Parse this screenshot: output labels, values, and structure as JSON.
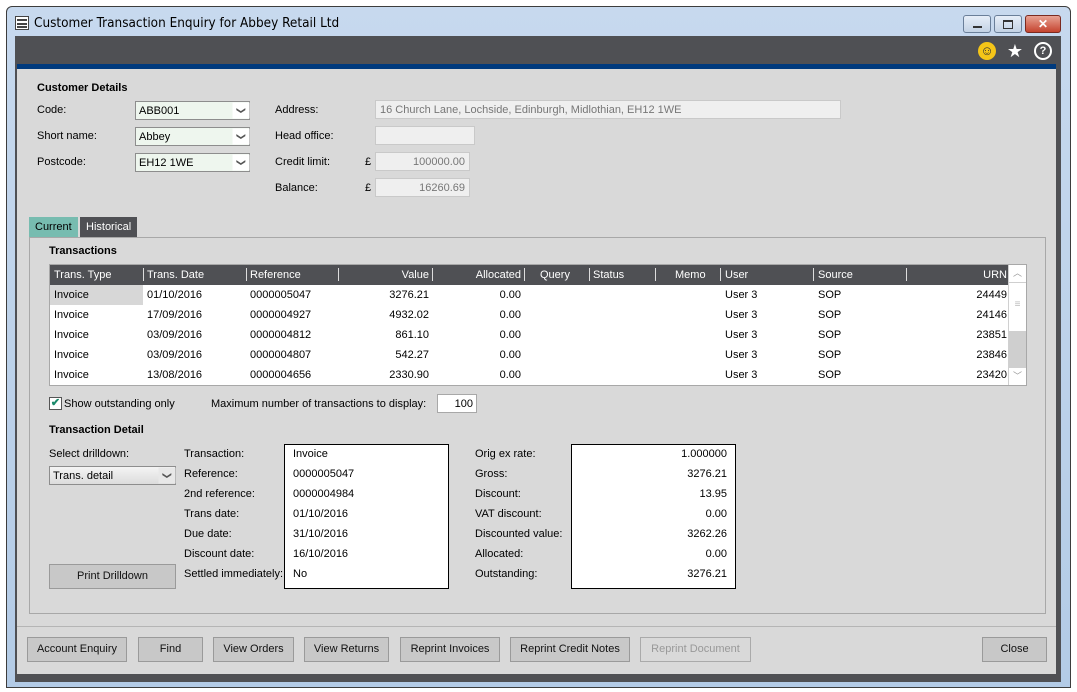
{
  "window": {
    "title": "Customer Transaction Enquiry for Abbey Retail Ltd",
    "controls": {
      "minimize": "–",
      "maximize": "□",
      "close": "✕"
    },
    "header_icons": {
      "feedback": "smiley-icon",
      "favourite": "star-icon",
      "help": "help-icon"
    }
  },
  "customer_details": {
    "heading": "Customer Details",
    "code_label": "Code:",
    "code_value": "ABB001",
    "short_name_label": "Short name:",
    "short_name_value": "Abbey",
    "postcode_label": "Postcode:",
    "postcode_value": "EH12 1WE",
    "address_label": "Address:",
    "address_value": "16 Church Lane, Lochside, Edinburgh, Midlothian, EH12 1WE",
    "head_office_label": "Head office:",
    "head_office_value": "",
    "credit_limit_label": "Credit limit:",
    "credit_limit_currency": "£",
    "credit_limit_value": "100000.00",
    "balance_label": "Balance:",
    "balance_currency": "£",
    "balance_value": "16260.69"
  },
  "tabs": [
    {
      "label": "Current",
      "active": true
    },
    {
      "label": "Historical",
      "active": false
    }
  ],
  "transactions": {
    "heading": "Transactions",
    "columns": [
      "Trans. Type",
      "Trans. Date",
      "Reference",
      "Value",
      "Allocated",
      "Query",
      "Status",
      "Memo",
      "User",
      "Source",
      "URN"
    ],
    "rows": [
      {
        "type": "Invoice",
        "date": "01/10/2016",
        "reference": "0000005047",
        "value": "3276.21",
        "allocated": "0.00",
        "query": "",
        "status": "",
        "memo": "",
        "user": "User 3",
        "source": "SOP",
        "urn": "24449"
      },
      {
        "type": "Invoice",
        "date": "17/09/2016",
        "reference": "0000004927",
        "value": "4932.02",
        "allocated": "0.00",
        "query": "",
        "status": "",
        "memo": "",
        "user": "User 3",
        "source": "SOP",
        "urn": "24146"
      },
      {
        "type": "Invoice",
        "date": "03/09/2016",
        "reference": "0000004812",
        "value": "861.10",
        "allocated": "0.00",
        "query": "",
        "status": "",
        "memo": "",
        "user": "User 3",
        "source": "SOP",
        "urn": "23851"
      },
      {
        "type": "Invoice",
        "date": "03/09/2016",
        "reference": "0000004807",
        "value": "542.27",
        "allocated": "0.00",
        "query": "",
        "status": "",
        "memo": "",
        "user": "User 3",
        "source": "SOP",
        "urn": "23846"
      },
      {
        "type": "Invoice",
        "date": "13/08/2016",
        "reference": "0000004656",
        "value": "2330.90",
        "allocated": "0.00",
        "query": "",
        "status": "",
        "memo": "",
        "user": "User 3",
        "source": "SOP",
        "urn": "23420"
      }
    ],
    "show_outstanding_label": "Show outstanding only",
    "show_outstanding_checked": true,
    "max_label": "Maximum number of transactions to display:",
    "max_value": "100"
  },
  "transaction_detail": {
    "heading": "Transaction Detail",
    "select_drilldown_label": "Select drilldown:",
    "drilldown_value": "Trans. detail",
    "print_button": "Print Drilldown",
    "left_fields": [
      {
        "label": "Transaction:",
        "value": "Invoice"
      },
      {
        "label": "Reference:",
        "value": "0000005047"
      },
      {
        "label": "2nd reference:",
        "value": "0000004984"
      },
      {
        "label": "Trans date:",
        "value": "01/10/2016"
      },
      {
        "label": "Due date:",
        "value": "31/10/2016"
      },
      {
        "label": "Discount date:",
        "value": "16/10/2016"
      },
      {
        "label": "Settled immediately:",
        "value": "No"
      }
    ],
    "right_fields": [
      {
        "label": "Orig ex rate:",
        "value": "1.000000"
      },
      {
        "label": "Gross:",
        "value": "3276.21"
      },
      {
        "label": "Discount:",
        "value": "13.95"
      },
      {
        "label": "VAT discount:",
        "value": "0.00"
      },
      {
        "label": "Discounted value:",
        "value": "3262.26"
      },
      {
        "label": "Allocated:",
        "value": "0.00"
      },
      {
        "label": "Outstanding:",
        "value": "3276.21"
      }
    ]
  },
  "footer_buttons": {
    "account_enquiry": "Account Enquiry",
    "find": "Find",
    "view_orders": "View Orders",
    "view_returns": "View Returns",
    "reprint_invoices": "Reprint Invoices",
    "reprint_credit_notes": "Reprint Credit Notes",
    "reprint_document": "Reprint Document",
    "close": "Close"
  }
}
